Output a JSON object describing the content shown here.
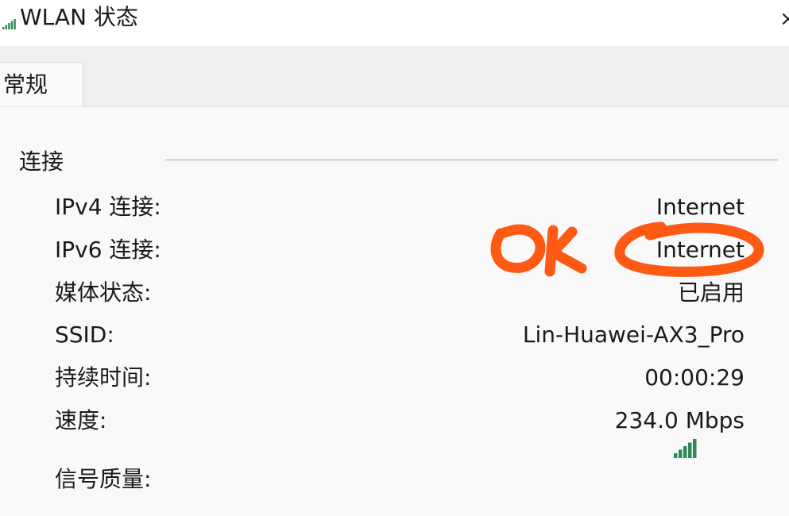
{
  "window": {
    "title": "WLAN 状态",
    "close_glyph": "×",
    "title_icon": "wifi-signal-icon"
  },
  "tabs": [
    {
      "label": "常规",
      "selected": true
    }
  ],
  "connection": {
    "heading": "连接",
    "rows": [
      {
        "label": "IPv4 连接:",
        "value": "Internet"
      },
      {
        "label": "IPv6 连接:",
        "value": "Internet"
      },
      {
        "label": "媒体状态:",
        "value": "已启用"
      },
      {
        "label": "SSID:",
        "value": "Lin-Huawei-AX3_Pro"
      },
      {
        "label": "持续时间:",
        "value": "00:00:29"
      },
      {
        "label": "速度:",
        "value": "234.0 Mbps"
      }
    ],
    "signal": {
      "label": "信号质量:",
      "icon": "signal-strength-icon",
      "bars_filled": 5,
      "bars_total": 5
    }
  },
  "annotation": {
    "text": "OK",
    "color": "#ff5a14",
    "circled_value": "Internet"
  }
}
